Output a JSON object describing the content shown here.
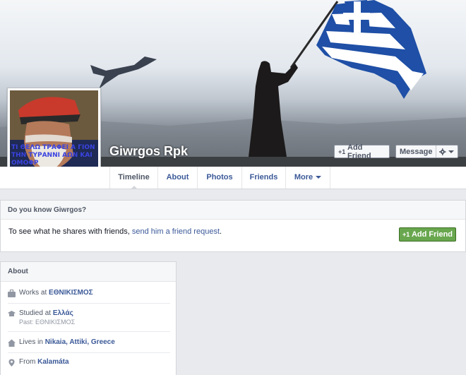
{
  "profile": {
    "name": "Giwrgos Rpk",
    "avatar_text": "ΤΙ ΘΕΛΩ ΤΡΑΦΕΙ Α ΓΙΟΝ ΤΗΝ ΤΥΡΑΝΝΙ ΑΩΝ ΚΑΙ ΟΜΟΦΡ"
  },
  "cover_actions": {
    "add_friend": "Add Friend",
    "message": "Message"
  },
  "tabs": [
    {
      "label": "Timeline"
    },
    {
      "label": "About"
    },
    {
      "label": "Photos"
    },
    {
      "label": "Friends"
    },
    {
      "label": "More"
    }
  ],
  "know_box": {
    "title": "Do you know Giwrgos?",
    "text_prefix": "To see what he shares with friends, ",
    "link": "send him a friend request",
    "text_suffix": ".",
    "button": "Add Friend"
  },
  "about": {
    "title": "About",
    "work": {
      "prefix": "Works at ",
      "value": "ΕΘΝΙΚΙΣΜΟΣ"
    },
    "education": {
      "prefix": "Studied at ",
      "value": "Ελλάς",
      "sub": "Past: ΕΘΝΙΚΙΣΜΟΣ"
    },
    "lives": {
      "prefix": "Lives in ",
      "value": "Nikaia, Attiki, Greece"
    },
    "from": {
      "prefix": "From ",
      "value": "Kalamáta"
    }
  },
  "colors": {
    "link": "#3b5998",
    "green_button": "#69a74e",
    "page_bg": "#e9eaed"
  },
  "icons": [
    "plus-person-icon",
    "gear-icon",
    "chevron-down-icon",
    "briefcase-icon",
    "graduation-icon",
    "home-icon",
    "map-pin-icon"
  ]
}
